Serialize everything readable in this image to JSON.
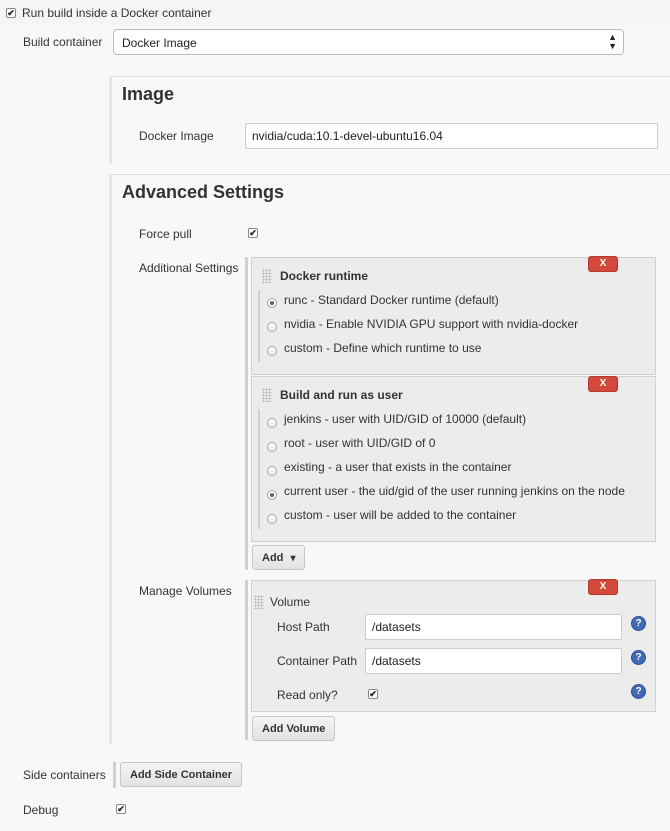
{
  "docker_toggle": {
    "label": "Run build inside a Docker container",
    "checked": true
  },
  "build_container": {
    "label": "Build container",
    "value": "Docker Image"
  },
  "image_section": {
    "title": "Image",
    "docker_image_label": "Docker Image",
    "docker_image_value": "nvidia/cuda:10.1-devel-ubuntu16.04"
  },
  "advanced": {
    "title": "Advanced Settings",
    "force_pull_label": "Force pull",
    "additional_label": "Additional Settings",
    "runtime": {
      "title": "Docker runtime",
      "remove": "X",
      "options": [
        {
          "label": "runc - Standard Docker runtime (default)",
          "selected": true
        },
        {
          "label": "nvidia - Enable NVIDIA GPU support with nvidia-docker",
          "selected": false
        },
        {
          "label": "custom - Define which runtime to use",
          "selected": false
        }
      ]
    },
    "user": {
      "title": "Build and run as user",
      "remove": "X",
      "options": [
        {
          "label": "jenkins - user with UID/GID of 10000 (default)",
          "selected": false
        },
        {
          "label": "root - user with UID/GID of 0",
          "selected": false
        },
        {
          "label": "existing - a user that exists in the container",
          "selected": false
        },
        {
          "label": "current user - the uid/gid of the user running jenkins on the node",
          "selected": true
        },
        {
          "label": "custom - user will be added to the container",
          "selected": false
        }
      ]
    },
    "add_button": "Add"
  },
  "volumes": {
    "label": "Manage Volumes",
    "remove": "X",
    "volume_title": "Volume",
    "host_path_label": "Host Path",
    "host_path_value": "/datasets",
    "container_path_label": "Container Path",
    "container_path_value": "/datasets",
    "read_only_label": "Read only?",
    "help": "?",
    "add_volume_button": "Add Volume"
  },
  "side_containers": {
    "label": "Side containers",
    "button": "Add Side Container"
  },
  "debug": {
    "label": "Debug"
  },
  "icons": {
    "checkbox_mark": "✔",
    "select_arrows": "▲▼",
    "dropdown_caret": "▾"
  }
}
